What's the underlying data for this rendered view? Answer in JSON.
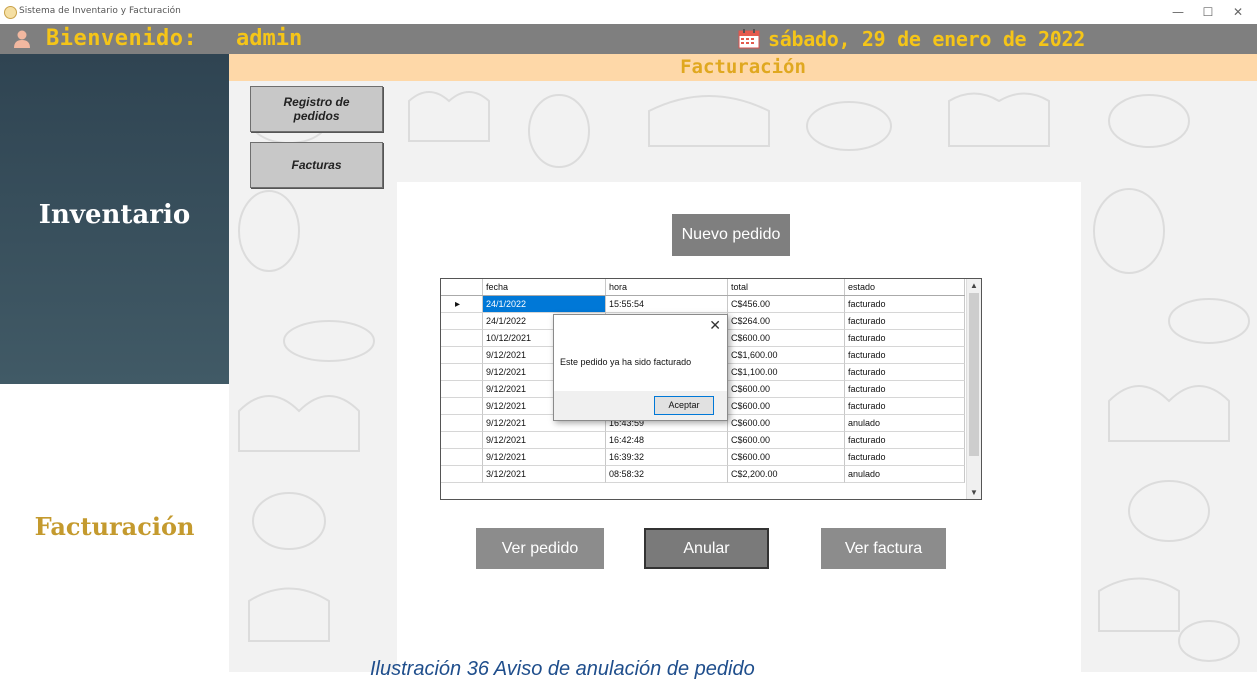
{
  "window": {
    "title": "Sistema de Inventario y Facturación",
    "controls": [
      "—",
      "☐",
      "✕"
    ]
  },
  "header": {
    "welcome": "Bienvenido:",
    "username": "admin",
    "date": "sábado, 29 de enero de 2022",
    "accent_color": "#f5c518",
    "icons": [
      "user-icon",
      "calendar-icon"
    ]
  },
  "sidebar": {
    "inventario": "Inventario",
    "facturacion": "Facturación"
  },
  "section": {
    "title": "Facturación"
  },
  "subnav": {
    "registro_line1": "Registro de",
    "registro_line2": "pedidos",
    "facturas": "Facturas"
  },
  "actions": {
    "nuevo_pedido": "Nuevo pedido",
    "ver_pedido": "Ver pedido",
    "anular": "Anular",
    "ver_factura": "Ver factura"
  },
  "table": {
    "columns": [
      "fecha",
      "hora",
      "total",
      "estado"
    ],
    "rows": [
      [
        "24/1/2022",
        "15:55:54",
        "C$456.00",
        "facturado"
      ],
      [
        "24/1/2022",
        "",
        "C$264.00",
        "facturado"
      ],
      [
        "10/12/2021",
        "",
        "C$600.00",
        "facturado"
      ],
      [
        "9/12/2021",
        "",
        "C$1,600.00",
        "facturado"
      ],
      [
        "9/12/2021",
        "",
        "C$1,100.00",
        "facturado"
      ],
      [
        "9/12/2021",
        "",
        "C$600.00",
        "facturado"
      ],
      [
        "9/12/2021",
        "",
        "C$600.00",
        "facturado"
      ],
      [
        "9/12/2021",
        "16:43:59",
        "C$600.00",
        "anulado"
      ],
      [
        "9/12/2021",
        "16:42:48",
        "C$600.00",
        "facturado"
      ],
      [
        "9/12/2021",
        "16:39:32",
        "C$600.00",
        "facturado"
      ],
      [
        "3/12/2021",
        "08:58:32",
        "C$2,200.00",
        "anulado"
      ]
    ],
    "selected_row": 0
  },
  "dialog": {
    "message": "Este pedido ya ha sido facturado",
    "ok": "Aceptar",
    "close": "✕"
  },
  "caption": "Ilustración 36 Aviso de anulación de pedido"
}
